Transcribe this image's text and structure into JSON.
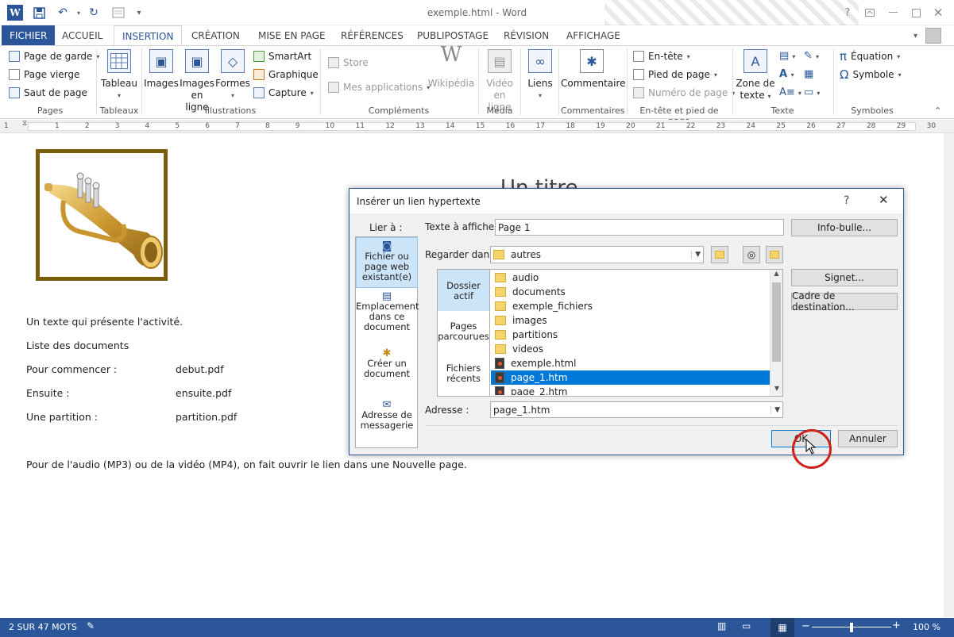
{
  "window": {
    "title": "exemple.html - Word"
  },
  "quick_access": {
    "undo": "↶",
    "redo": "↻"
  },
  "tabs": [
    "FICHIER",
    "ACCUEIL",
    "INSERTION",
    "CRÉATION",
    "MISE EN PAGE",
    "RÉFÉRENCES",
    "PUBLIPOSTAGE",
    "RÉVISION",
    "AFFICHAGE"
  ],
  "ribbon": {
    "pages": {
      "label": "Pages",
      "cover": "Page de garde",
      "blank": "Page vierge",
      "break": "Saut de page"
    },
    "tables": {
      "label": "Tableaux",
      "table": "Tableau"
    },
    "illustrations": {
      "label": "Illustrations",
      "images": "Images",
      "online1": "Images",
      "online2": "en ligne",
      "shapes": "Formes",
      "smartart": "SmartArt",
      "chart": "Graphique",
      "capture": "Capture"
    },
    "addins": {
      "label": "Compléments",
      "store": "Store",
      "myapps": "Mes applications",
      "wikipedia": "Wikipédia"
    },
    "media": {
      "label": "Média",
      "video1": "Vidéo",
      "video2": "en ligne"
    },
    "links": {
      "label": "Liens"
    },
    "comments": {
      "label": "Commentaires",
      "comment": "Commentaire"
    },
    "headerfooter": {
      "label": "En-tête et pied de page",
      "header": "En-tête",
      "footer": "Pied de page",
      "pagenum": "Numéro de page"
    },
    "text": {
      "label": "Texte",
      "textbox1": "Zone de",
      "textbox2": "texte"
    },
    "symbols": {
      "label": "Symboles",
      "equation": "Équation",
      "symbol": "Symbole"
    }
  },
  "ruler_ticks": [
    "1",
    "1",
    "2",
    "3",
    "4",
    "5",
    "6",
    "7",
    "8",
    "9",
    "10",
    "11",
    "12",
    "13",
    "14",
    "15",
    "16",
    "17",
    "18",
    "19",
    "20",
    "21",
    "22",
    "23",
    "24",
    "25",
    "26",
    "27",
    "28",
    "29",
    "30"
  ],
  "document": {
    "heading_partial": "Un titre",
    "intro": "Un texte qui présente l'activité.",
    "list_title": "Liste des documents",
    "rows": [
      {
        "label": "Pour commencer :",
        "file": "debut.pdf"
      },
      {
        "label": "Ensuite :",
        "file": "ensuite.pdf"
      },
      {
        "label": "Une partition :",
        "file": "partition.pdf"
      }
    ],
    "footer_text": "Pour de l'audio (MP3) ou de la vidéo (MP4), on fait ouvrir le lien dans une Nouvelle page."
  },
  "dialog": {
    "title": "Insérer un lien hypertexte",
    "help": "?",
    "link_to": "Lier à :",
    "nav": [
      {
        "l1": "Fichier ou",
        "l2": "page web",
        "l3": "existant(e)"
      },
      {
        "l1": "Emplacement",
        "l2": "dans ce",
        "l3": "document"
      },
      {
        "l1": "Créer un",
        "l2": "document",
        "l3": ""
      },
      {
        "l1": "Adresse de",
        "l2": "messagerie",
        "l3": ""
      }
    ],
    "text_label": "Texte à afficher :",
    "text_value": "Page 1",
    "tooltip_btn": "Info-bulle...",
    "look_in_label": "Regarder dans :",
    "look_in_value": "autres",
    "sub_nav": [
      {
        "l1": "Dossier",
        "l2": "actif"
      },
      {
        "l1": "Pages",
        "l2": "parcourues"
      },
      {
        "l1": "Fichiers",
        "l2": "récents"
      }
    ],
    "files": [
      {
        "name": "audio",
        "type": "folder"
      },
      {
        "name": "documents",
        "type": "folder"
      },
      {
        "name": "exemple_fichiers",
        "type": "folder"
      },
      {
        "name": "images",
        "type": "folder"
      },
      {
        "name": "partitions",
        "type": "folder"
      },
      {
        "name": "videos",
        "type": "folder"
      },
      {
        "name": "exemple.html",
        "type": "html"
      },
      {
        "name": "page_1.htm",
        "type": "html",
        "selected": true
      },
      {
        "name": "page_2.htm",
        "type": "html"
      }
    ],
    "bookmark_btn": "Signet...",
    "target_btn": "Cadre de destination...",
    "address_label": "Adresse :",
    "address_value": "page_1.htm",
    "ok": "OK",
    "cancel": "Annuler"
  },
  "statusbar": {
    "words": "2 SUR 47 MOTS",
    "zoom": "100 %",
    "zoom_level": 0.5
  },
  "colors": {
    "accent": "#2b579a",
    "frame": "#7a5d0a",
    "selection": "#0078d7",
    "cursor_ring": "#d0201a"
  }
}
